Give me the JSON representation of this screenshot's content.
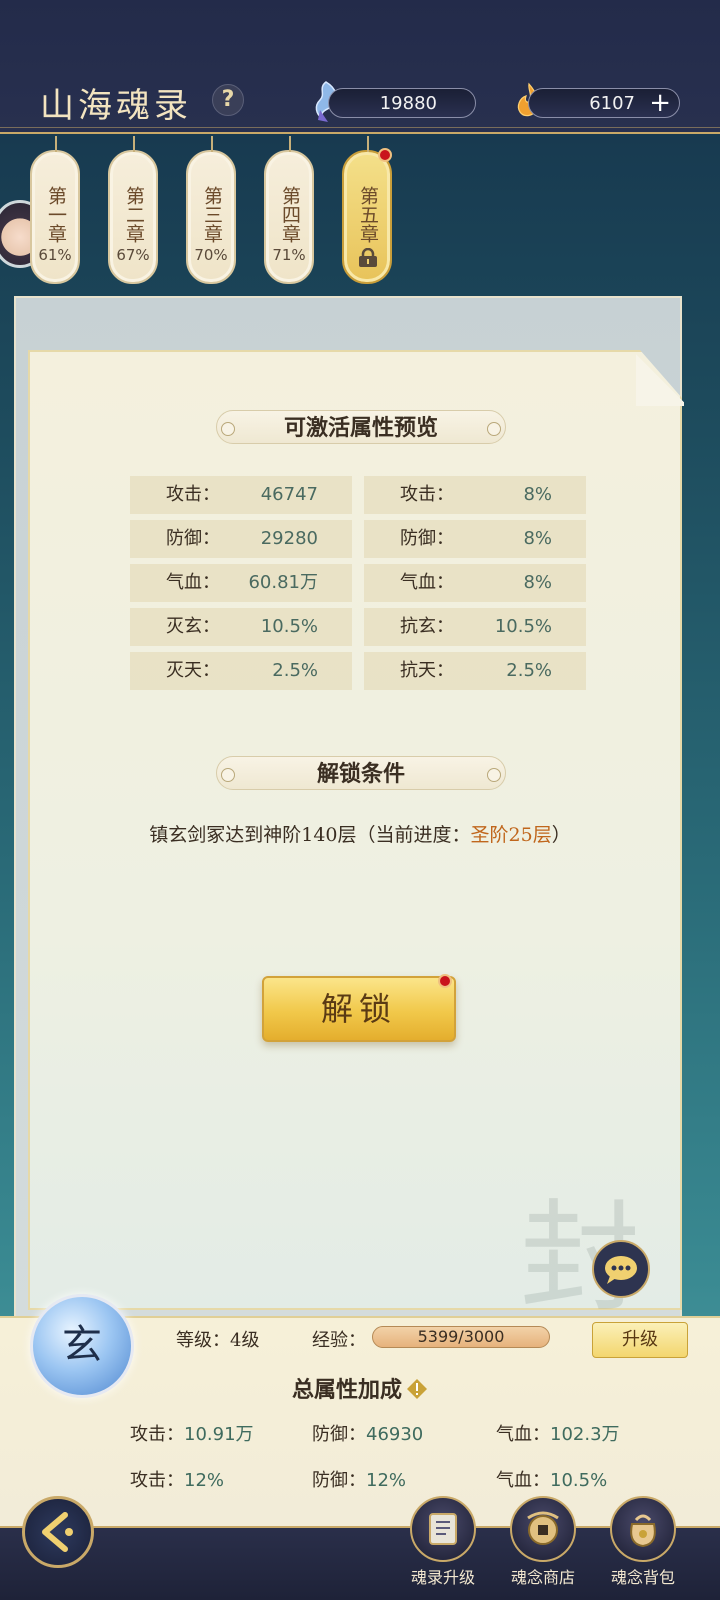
{
  "header": {
    "title": "山海魂录",
    "help_symbol": "?",
    "resource1_value": "19880",
    "resource2_value": "6107",
    "plus_symbol": "+"
  },
  "chapters": [
    {
      "label": "第一章",
      "percent": "61%"
    },
    {
      "label": "第二章",
      "percent": "67%"
    },
    {
      "label": "第三章",
      "percent": "70%"
    },
    {
      "label": "第四章",
      "percent": "71%"
    },
    {
      "label": "第五章",
      "percent": ""
    }
  ],
  "preview": {
    "title": "可激活属性预览",
    "rows": [
      {
        "label": "攻击：",
        "value": "46747"
      },
      {
        "label": "防御：",
        "value": "29280"
      },
      {
        "label": "气血：",
        "value": "60.81万"
      },
      {
        "label": "灭玄：",
        "value": "10.5%"
      },
      {
        "label": "灭天：",
        "value": "2.5%"
      },
      {
        "label": "攻击：",
        "value": "8%"
      },
      {
        "label": "防御：",
        "value": "8%"
      },
      {
        "label": "气血：",
        "value": "8%"
      },
      {
        "label": "抗玄：",
        "value": "10.5%"
      },
      {
        "label": "抗天：",
        "value": "2.5%"
      }
    ]
  },
  "unlock": {
    "title": "解锁条件",
    "condition_prefix": "镇玄剑冢达到神阶140层（当前进度：",
    "condition_highlight": "圣阶25层",
    "condition_suffix": "）",
    "button_label": "解锁"
  },
  "seal_char": "封",
  "bottom": {
    "orb_char": "玄",
    "level_label": "等级：",
    "level_value": "4级",
    "exp_label": "经验：",
    "exp_value": "5399/3000",
    "upgrade_label": "升级",
    "total_title": "总属性加成",
    "bonuses": [
      {
        "label": "攻击：",
        "value": "10.91万"
      },
      {
        "label": "防御：",
        "value": "46930"
      },
      {
        "label": "气血：",
        "value": "102.3万"
      },
      {
        "label": "攻击：",
        "value": "12%"
      },
      {
        "label": "防御：",
        "value": "12%"
      },
      {
        "label": "气血：",
        "value": "10.5%"
      }
    ]
  },
  "nav": [
    {
      "label": "魂录升级",
      "icon": "scroll-upgrade-icon"
    },
    {
      "label": "魂念商店",
      "icon": "shop-icon"
    },
    {
      "label": "魂念背包",
      "icon": "bag-icon"
    }
  ],
  "colors": {
    "accent_gold": "#c9a968",
    "highlight_orange": "#c0661c",
    "value_green": "#4a6a60"
  }
}
